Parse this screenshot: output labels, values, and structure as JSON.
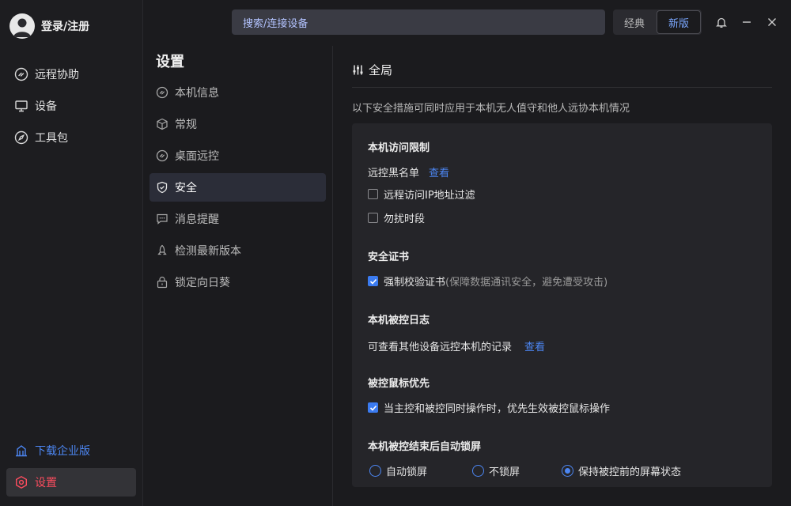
{
  "profile": {
    "label": "登录/注册"
  },
  "nav": {
    "items": [
      {
        "label": "远程协助",
        "icon": "remote-assist-icon"
      },
      {
        "label": "设备",
        "icon": "monitor-icon"
      },
      {
        "label": "工具包",
        "icon": "compass-icon"
      }
    ],
    "download": {
      "label": "下载企业版",
      "icon": "enterprise-icon"
    },
    "settings": {
      "label": "设置",
      "icon": "settings-hex-icon"
    }
  },
  "topbar": {
    "search_text": "搜索/连接设备",
    "classic_label": "经典",
    "new_label": "新版"
  },
  "menu": {
    "title": "设置",
    "items": [
      {
        "label": "本机信息",
        "icon": "info-icon"
      },
      {
        "label": "常规",
        "icon": "cube-icon"
      },
      {
        "label": "桌面远控",
        "icon": "desktop-remote-icon"
      },
      {
        "label": "安全",
        "icon": "shield-icon"
      },
      {
        "label": "消息提醒",
        "icon": "message-icon"
      },
      {
        "label": "检测最新版本",
        "icon": "rocket-icon"
      },
      {
        "label": "锁定向日葵",
        "icon": "lock-icon"
      }
    ]
  },
  "content": {
    "section_title": "全局",
    "description": "以下安全措施可同时应用于本机无人值守和他人远协本机情况",
    "access": {
      "title": "本机访问限制",
      "blacklist_label": "远控黑名单",
      "blacklist_link": "查看",
      "ip_filter_label": "远程访问IP地址过滤",
      "dnd_label": "勿扰时段"
    },
    "cert": {
      "title": "安全证书",
      "verify_label": "强制校验证书",
      "verify_hint": "(保障数据通讯安全，避免遭受攻击)"
    },
    "log": {
      "title": "本机被控日志",
      "desc": "可查看其他设备远控本机的记录",
      "link": "查看"
    },
    "mouse": {
      "title": "被控鼠标优先",
      "option_label": "当主控和被控同时操作时，优先生效被控鼠标操作"
    },
    "lock": {
      "title": "本机被控结束后自动锁屏",
      "options": [
        "自动锁屏",
        "不锁屏",
        "保持被控前的屏幕状态"
      ]
    }
  }
}
